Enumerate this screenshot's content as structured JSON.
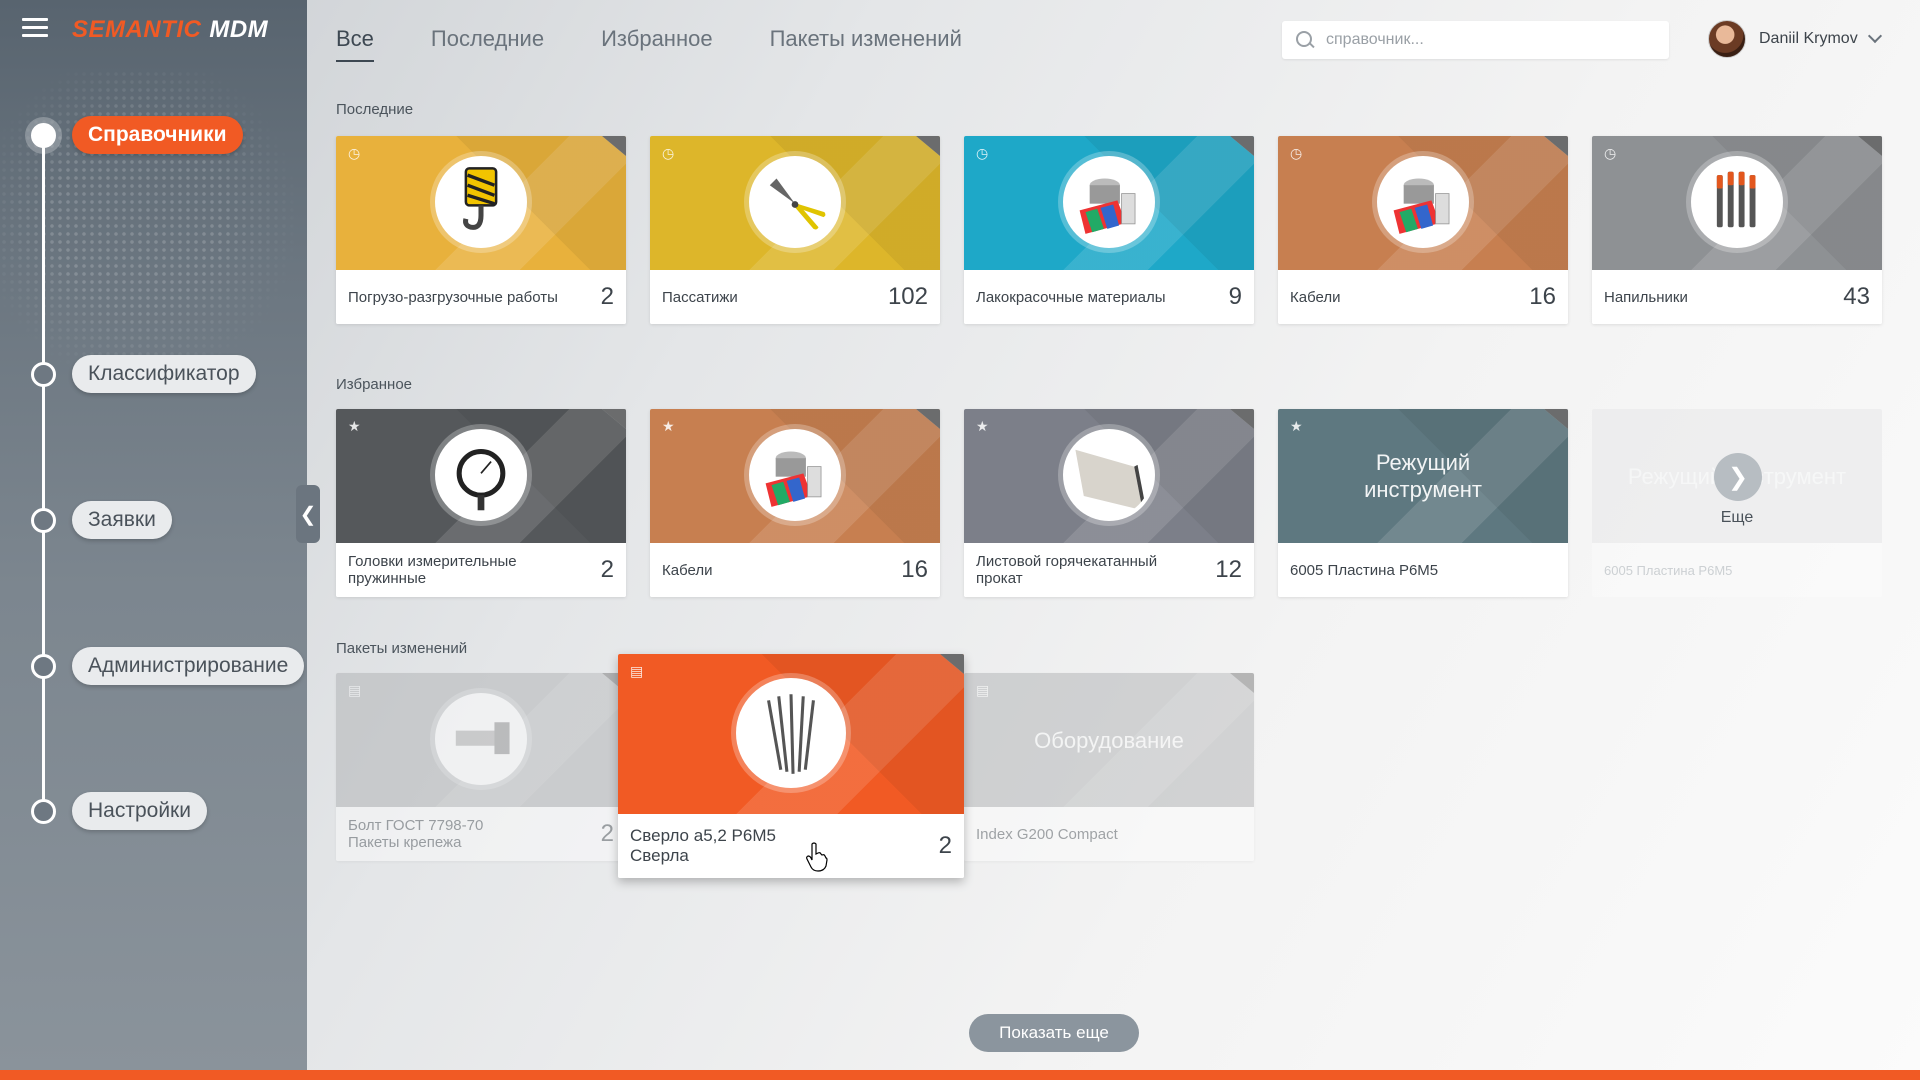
{
  "app": {
    "logo_part1": "SEMANTIC",
    "logo_part2": "MDM"
  },
  "sidebar": {
    "items": [
      {
        "label": "Справочники",
        "active": true
      },
      {
        "label": "Классификатор"
      },
      {
        "label": "Заявки"
      },
      {
        "label": "Администрирование"
      },
      {
        "label": "Настройки"
      }
    ]
  },
  "header": {
    "tabs": [
      {
        "label": "Все",
        "active": true
      },
      {
        "label": "Последние"
      },
      {
        "label": "Избранное"
      },
      {
        "label": "Пакеты изменений"
      }
    ],
    "search_placeholder": "справочник...",
    "user_name": "Daniil Krymov"
  },
  "sections": {
    "recent": {
      "title": "Последние",
      "cards": [
        {
          "name": "Погрузо-разгрузочные работы",
          "count": "2",
          "color": "#e8b13c",
          "icon": "crane-hook-icon"
        },
        {
          "name": "Пассатижи",
          "count": "102",
          "color": "#ddb62a",
          "icon": "pliers-icon"
        },
        {
          "name": "Лакокрасочные материалы",
          "count": "9",
          "color": "#1ea8c8",
          "icon": "paint-icon"
        },
        {
          "name": "Кабели",
          "count": "16",
          "color": "#c77f50",
          "icon": "paint-icon"
        },
        {
          "name": "Напильники",
          "count": "43",
          "color": "#8e9194",
          "icon": "files-icon"
        }
      ]
    },
    "favorites": {
      "title": "Избранное",
      "cards": [
        {
          "name": "Головки измерительные пружинные",
          "count": "2",
          "color": "#55585b",
          "icon": "gauge-icon"
        },
        {
          "name": "Кабели",
          "count": "16",
          "color": "#c77f50",
          "icon": "paint-icon"
        },
        {
          "name": "Листовой горячекатанный прокат",
          "count": "12",
          "color": "#7c7f89",
          "icon": "sheet-metal-icon"
        },
        {
          "name": "6005 Пластина Р6М5",
          "count": "",
          "color": "#5e7880",
          "text": "Режущий инструмент",
          "ghost": "Режущий\nинструмен"
        }
      ],
      "more": {
        "label": "Еще",
        "faded_text": "Режущий инструмент",
        "faded_name": "6005 Пластина Р6М5"
      }
    },
    "packages": {
      "title": "Пакеты изменений",
      "cards": [
        {
          "name_line1": "Болт ГОСТ 7798-70",
          "name_line2": "Пакеты крепежа",
          "count": "2",
          "color": "#a6acb0",
          "icon": "bolt-icon"
        },
        {
          "name_line1": "Сверло а5,2 Р6М5",
          "name_line2": "Сверла",
          "count": "2",
          "color": "#f15a24",
          "icon": "drill-icon"
        },
        {
          "name_line1": "Index G200 Compact",
          "count": "",
          "color": "#a6acb0",
          "text": "Оборудование"
        }
      ]
    }
  },
  "show_more_label": "Показать еще",
  "colors": {
    "accent": "#f15a24",
    "sidebar": "#6b7680"
  }
}
